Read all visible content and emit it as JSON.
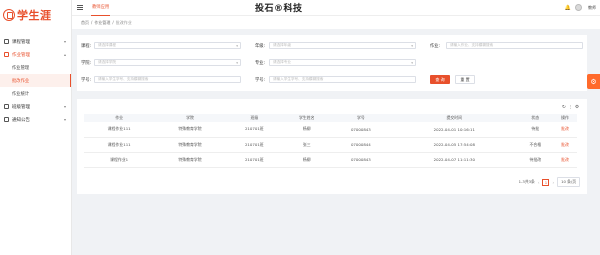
{
  "sidebar": {
    "logo": "学生涯",
    "items": [
      {
        "label": "课程管理",
        "arrow": "▾"
      },
      {
        "label": "作业管理",
        "arrow": "▴"
      },
      {
        "label": "作业管理"
      },
      {
        "label": "批改作业"
      },
      {
        "label": "作业统计"
      },
      {
        "label": "班级管理",
        "arrow": "▾"
      },
      {
        "label": "通知公告",
        "arrow": "▾"
      }
    ]
  },
  "header": {
    "tab": "教师应用",
    "brand": "投石®科技",
    "bell": "🔔",
    "user": "教师"
  },
  "breadcrumb": [
    "首页",
    "/",
    "作业管理",
    "/",
    "批改作业"
  ],
  "filters": {
    "course_label": "课程:",
    "course_ph": "请选择课程",
    "grade_label": "年级:",
    "grade_ph": "请选择年级",
    "homework_label": "作业:",
    "homework_ph": "请输入作业、支持模糊搜索",
    "college_label": "学院:",
    "college_ph": "请选择学院",
    "major_label": "专业:",
    "major_ph": "请选择专业",
    "studentid_label": "学号:",
    "studentid_ph": "请输入学生学号、支持模糊搜索",
    "name_label": "学号:",
    "name_ph": "请输入学生学号、支持模糊搜索",
    "search": "查 询",
    "reset": "重 置"
  },
  "fab": "⚙",
  "toolbar": {
    "refresh": "↻",
    "columns": "⫶",
    "settings": "⚙"
  },
  "table": {
    "headers": [
      "作业",
      "学院",
      "班级",
      "学生姓名",
      "学号",
      "提交时间",
      "状态",
      "操作"
    ],
    "rows": [
      [
        "课程作业111",
        "特殊教育学院",
        "210701班",
        "杨柳",
        "07000843",
        "2022-04-01 10:16:11",
        "待批",
        "批改"
      ],
      [
        "课程作业111",
        "特殊教育学院",
        "210701班",
        "张三",
        "07000844",
        "2022-04-05 17:54:08",
        "不合格",
        "批改"
      ],
      [
        "课程作业1",
        "特殊教育学院",
        "210701班",
        "杨柳",
        "07000843",
        "2022-04-07 11:11:30",
        "待批改",
        "批改"
      ]
    ]
  },
  "pager": {
    "total": "1-3共3条",
    "prev": "‹",
    "page": "1",
    "next": "›",
    "size": "10 条/页"
  }
}
